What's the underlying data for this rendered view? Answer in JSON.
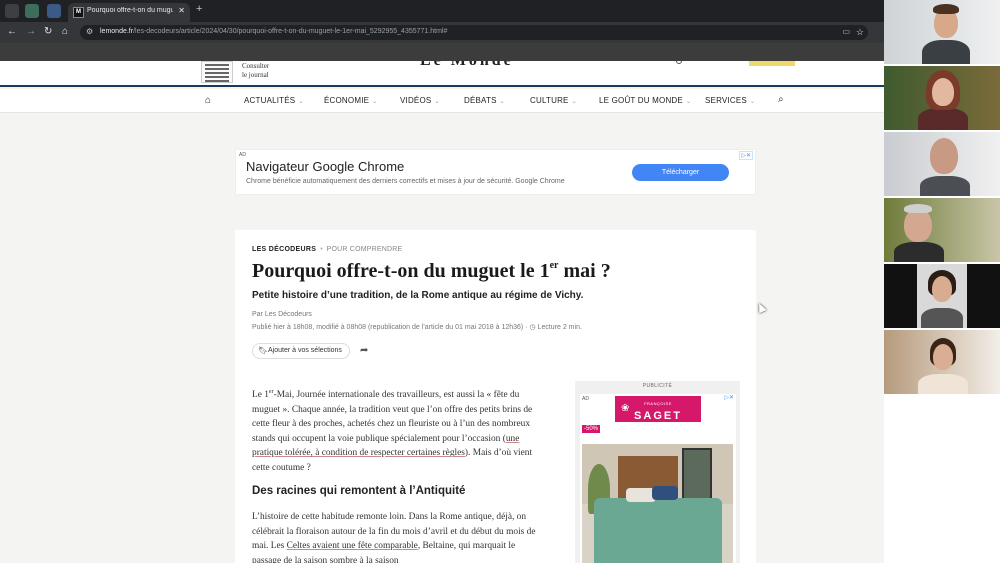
{
  "browser": {
    "tab_title": "Pourquoi offre-t-on du muguet",
    "tab_favicon_text": "M",
    "url_domain": "lemonde.fr",
    "url_path": "/les-decodeurs/article/2024/04/30/pourquoi-offre-t-on-du-muguet-le-1er-mai_5292955_4355771.html#"
  },
  "site": {
    "consult_line1": "Consulter",
    "consult_line2": "le journal",
    "logo": "Le Monde",
    "nav": [
      {
        "label": "ACTUALITÉS"
      },
      {
        "label": "ÉCONOMIE"
      },
      {
        "label": "VIDÉOS"
      },
      {
        "label": "DÉBATS"
      },
      {
        "label": "CULTURE"
      },
      {
        "label": "LE GOÛT DU MONDE"
      },
      {
        "label": "SERVICES"
      }
    ]
  },
  "ad_banner": {
    "tag": "AD",
    "headline": "Navigateur Google Chrome",
    "text": "Chrome bénéficie automatiquement des derniers correctifs et mises à jour de sécurité. Google Chrome",
    "button": "Télécharger"
  },
  "article": {
    "section": "LES DÉCODEURS",
    "subsection": "POUR COMPRENDRE",
    "title_a": "Pourquoi offre-t-on du muguet le 1",
    "title_sup": "er",
    "title_b": " mai ?",
    "subtitle": "Petite histoire d’une tradition, de la Rome antique au régime de Vichy.",
    "byline": "Par Les Décodeurs",
    "dates": "Publié hier à 18h08, modifié à 08h08 (republication de l’article du 01 mai 2018 à 12h36)",
    "read_time": "Lecture 2 min.",
    "save_label": "Ajouter à vos sélections",
    "p1_a": "Le 1",
    "p1_sup": "er",
    "p1_b": "-Mai, Journée internationale des travailleurs, est aussi la « fête du muguet ». Chaque année, la tradition veut que l’on offre des petits brins de cette fleur à des proches, achetés chez un fleuriste ou à l’un des nombreux stands qui occupent la voie publique spécialement pour l’occasion (",
    "p1_link": "une pratique tolérée, à condition de respecter certaines règles",
    "p1_c": "). Mais d’où vient cette coutume ?",
    "h2": "Des racines qui remontent à l’Antiquité",
    "p2_a": "L’histoire de cette habitude remonte loin. Dans la Rome antique, déjà, on célébrait la floraison autour de la fin du mois d’avril et du début du mois de mai. Les ",
    "p2_link": "Celtes avaient une fête comparable",
    "p2_b": ", Beltaine, qui marquait le passage de la saison sombre à la saison"
  },
  "side_ad": {
    "label": "PUBLICITÉ",
    "tag": "AD",
    "brand_small": "FRANÇOISE",
    "brand": "SAGET",
    "promo": "-50%"
  },
  "colors": {
    "chrome_dark": "#202124",
    "nav_border": "#1a3a5c",
    "cta_blue": "#4285f4",
    "brand_pink": "#d6186b"
  }
}
